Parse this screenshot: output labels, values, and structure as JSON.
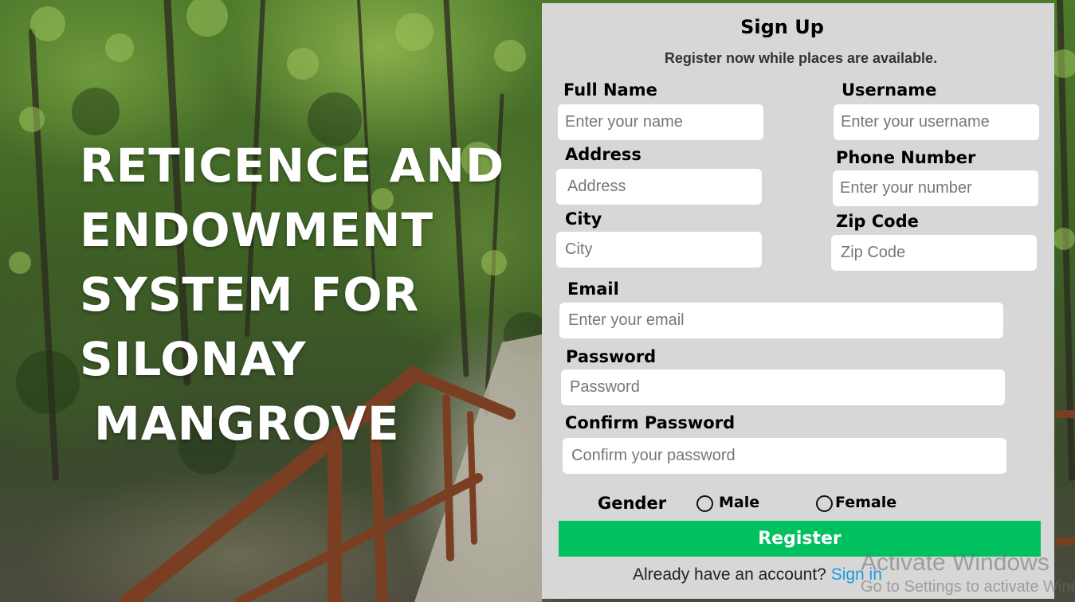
{
  "headline": {
    "lines": [
      "RETICENCE AND",
      "ENDOWMENT",
      "SYSTEM FOR",
      "SILONAY",
      "MANGROVE"
    ]
  },
  "form": {
    "title": "Sign Up",
    "subtitle": "Register now while places are available.",
    "fields": {
      "full_name": {
        "label": "Full Name",
        "placeholder": "Enter your name"
      },
      "username": {
        "label": "Username",
        "placeholder": "Enter your username"
      },
      "address": {
        "label": "Address",
        "placeholder": "Address"
      },
      "phone": {
        "label": "Phone Number",
        "placeholder": "Enter your number"
      },
      "city": {
        "label": "City",
        "placeholder": "City"
      },
      "zip": {
        "label": "Zip Code",
        "placeholder": "Zip Code"
      },
      "email": {
        "label": "Email",
        "placeholder": "Enter your email"
      },
      "password": {
        "label": "Password",
        "placeholder": "Password"
      },
      "confirm_password": {
        "label": "Confirm Password",
        "placeholder": "Confirm your password"
      }
    },
    "gender": {
      "label": "Gender",
      "options": [
        "Male",
        "Female"
      ],
      "selected": null
    },
    "register_label": "Register",
    "already_text": "Already have an account?",
    "signin_label": "Sign in"
  },
  "watermark": {
    "line1": "Activate Windows",
    "line2": "Go to Settings to activate Windows."
  },
  "colors": {
    "panel_bg": "#d7d7d7",
    "register_bg": "#00c060",
    "link": "#1a9be0"
  }
}
